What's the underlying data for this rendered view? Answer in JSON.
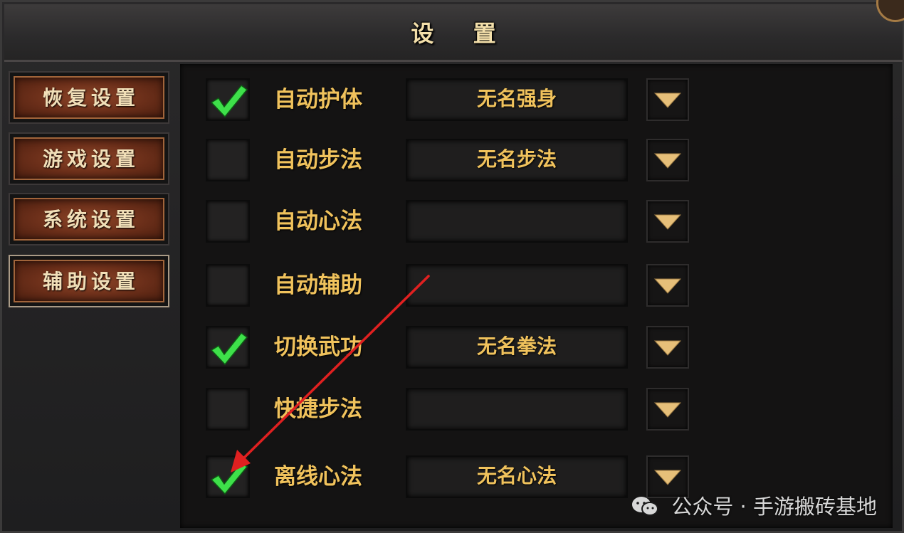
{
  "window": {
    "title": "设 置"
  },
  "sidebar": {
    "items": [
      {
        "label": "恢复设置",
        "active": false
      },
      {
        "label": "游戏设置",
        "active": false
      },
      {
        "label": "系统设置",
        "active": false
      },
      {
        "label": "辅助设置",
        "active": true
      }
    ]
  },
  "settings": {
    "rows": [
      {
        "label": "自动护体",
        "checked": true,
        "value": "无名强身"
      },
      {
        "label": "自动步法",
        "checked": false,
        "value": "无名步法"
      },
      {
        "label": "自动心法",
        "checked": false,
        "value": ""
      },
      {
        "label": "自动辅助",
        "checked": false,
        "value": ""
      },
      {
        "label": "切换武功",
        "checked": true,
        "value": "无名拳法"
      },
      {
        "label": "快捷步法",
        "checked": false,
        "value": ""
      },
      {
        "label": "离线心法",
        "checked": true,
        "value": "无名心法"
      }
    ]
  },
  "watermark": {
    "text": "公众号 · 手游搬砖基地"
  },
  "colors": {
    "label": "#f0c25c",
    "check": "#3ee04a",
    "arrow_annotation": "#e02020",
    "button_red": "#7a3520"
  },
  "icons": {
    "check": "checkmark-icon",
    "dropdown": "triangle-down-icon",
    "watermark": "wechat-icon"
  }
}
